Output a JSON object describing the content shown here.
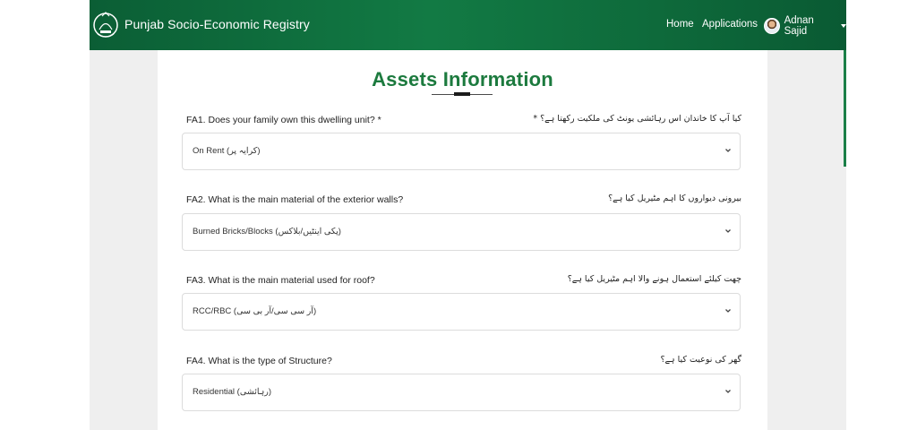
{
  "header": {
    "brand": "Punjab Socio-Economic Registry",
    "nav": {
      "home": "Home",
      "applications": "Applications"
    },
    "user": {
      "name": "Adnan Sajid"
    }
  },
  "page": {
    "title": "Assets Information"
  },
  "questions": [
    {
      "label": "FA1. Does your family own this dwelling unit? *",
      "urdu": "کیا آپ کا خاندان اس رہائشی یونٹ کی ملکیت رکھتا ہے؟ *",
      "value": "On Rent (کرایہ پر)"
    },
    {
      "label": "FA2. What is the main material of the exterior walls?",
      "urdu": "بیرونی دیواروں کا اہم مٹیریل کیا ہے؟",
      "value": "Burned Bricks/Blocks (پکی اینٹیں/بلاکس)"
    },
    {
      "label": "FA3. What is the main material used for roof?",
      "urdu": "چھت کیلئے استعمال ہونے والا اہم مٹیریل کیا ہے؟",
      "value": "RCC/RBC (آر سی سی/آر بی سی)"
    },
    {
      "label": "FA4. What is the type of Structure?",
      "urdu": "گھر کی نوعیت کیا ہے؟",
      "value": "Residential (رہائشی)"
    }
  ],
  "icons": {
    "logo": "punjab-emblem-icon",
    "select": "chevron-down-icon",
    "user_menu": "caret-down-icon"
  },
  "colors": {
    "header": "#127a44",
    "title": "#1c7a3e"
  }
}
